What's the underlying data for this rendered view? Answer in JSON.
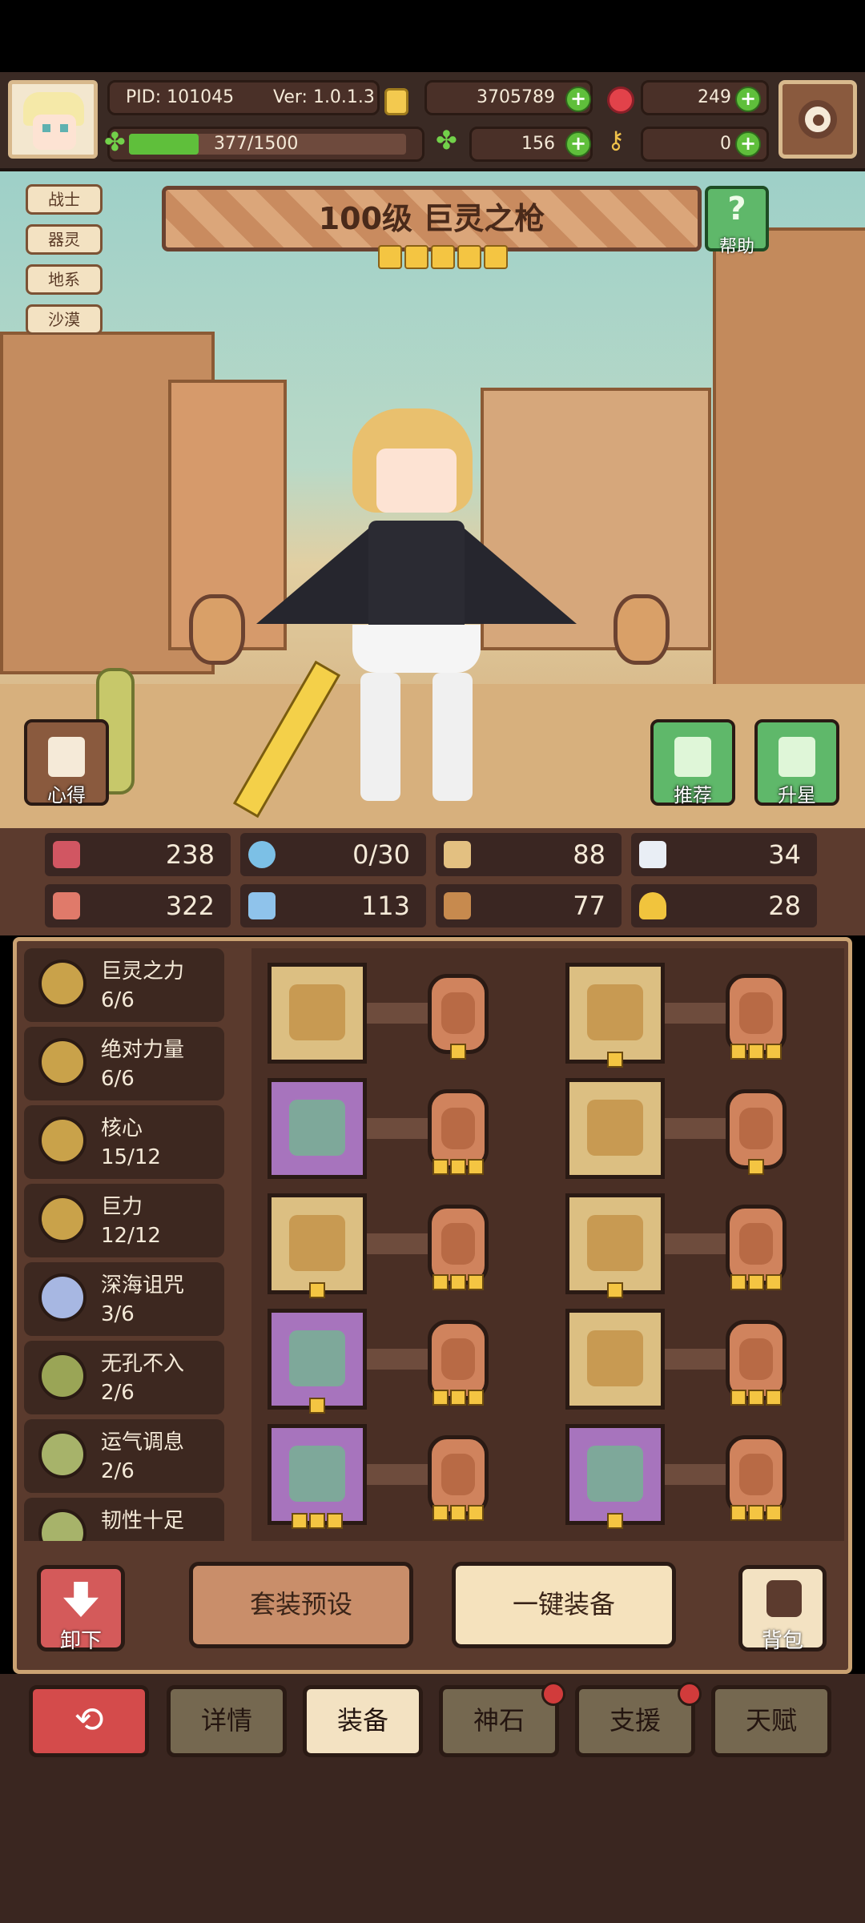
{
  "hud": {
    "pid": "PID: 101045",
    "version": "Ver: 1.0.1.3",
    "gold": "3705789",
    "gems": "249",
    "energy": "377/1500",
    "clovers": "156",
    "keys": "0",
    "energy_ratio": 0.251
  },
  "tags": [
    "战士",
    "器灵",
    "地系",
    "沙漠"
  ],
  "hero": {
    "title": "100级 巨灵之枪",
    "stars": 5,
    "help_label": "帮助",
    "notes_label": "心得",
    "recommend_label": "推荐",
    "upgrade_label": "升星"
  },
  "stats": {
    "hp": "238",
    "mana": "0/30",
    "defense": "88",
    "speed": "34",
    "attack": "322",
    "intelligence": "113",
    "block": "77",
    "crit": "28"
  },
  "sets": [
    {
      "name": "巨灵之力",
      "count": "6/6",
      "color": "#c9a24a"
    },
    {
      "name": "绝对力量",
      "count": "6/6",
      "color": "#c9a24a"
    },
    {
      "name": "核心",
      "count": "15/12",
      "color": "#c9a24a"
    },
    {
      "name": "巨力",
      "count": "12/12",
      "color": "#c9a24a"
    },
    {
      "name": "深海诅咒",
      "count": "3/6",
      "color": "#a7b7e2"
    },
    {
      "name": "无孔不入",
      "count": "2/6",
      "color": "#9aa556"
    },
    {
      "name": "运气调息",
      "count": "2/6",
      "color": "#a7b36a"
    },
    {
      "name": "韧性十足",
      "count": "",
      "color": "#a7b36a"
    }
  ],
  "equipment": [
    {
      "slot": "weapon",
      "rarity": "gold",
      "stars": 0,
      "rune_stars": 1
    },
    {
      "slot": "helmet",
      "rarity": "gold",
      "stars": 1,
      "rune_stars": 3
    },
    {
      "slot": "staff",
      "rarity": "purple",
      "stars": 0,
      "rune_stars": 3
    },
    {
      "slot": "armor",
      "rarity": "gold",
      "stars": 0,
      "rune_stars": 1
    },
    {
      "slot": "necklace",
      "rarity": "gold",
      "stars": 1,
      "rune_stars": 3
    },
    {
      "slot": "gloves",
      "rarity": "gold",
      "stars": 1,
      "rune_stars": 3
    },
    {
      "slot": "amulet",
      "rarity": "purple",
      "stars": 1,
      "rune_stars": 3
    },
    {
      "slot": "ring",
      "rarity": "gold",
      "stars": 0,
      "rune_stars": 3
    },
    {
      "slot": "trinket",
      "rarity": "purple",
      "stars": 3,
      "rune_stars": 3
    },
    {
      "slot": "boots",
      "rarity": "purple",
      "stars": 1,
      "rune_stars": 3
    }
  ],
  "actions": {
    "unequip": "卸下",
    "preset": "套装预设",
    "auto_equip": "一键装备",
    "bag": "背包"
  },
  "tabs": [
    {
      "label": "详情",
      "active": false,
      "badge": false
    },
    {
      "label": "装备",
      "active": true,
      "badge": false
    },
    {
      "label": "神石",
      "active": false,
      "badge": true
    },
    {
      "label": "支援",
      "active": false,
      "badge": true
    },
    {
      "label": "天赋",
      "active": false,
      "badge": false
    }
  ],
  "colors": {
    "panel": "#5a3a2d",
    "accent_green": "#5fbf3b",
    "tab_active": "#f3e2c2",
    "tab_inactive": "#756850",
    "back_button": "#d44b4b"
  }
}
